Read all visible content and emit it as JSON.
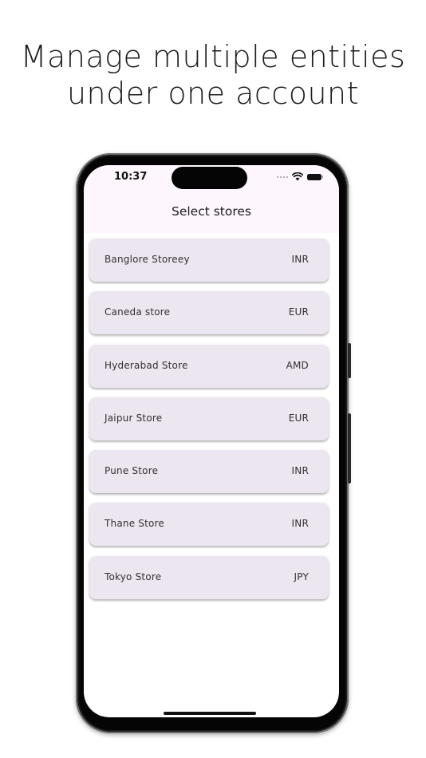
{
  "headline": {
    "line1": "Manage multiple entities",
    "line2": "under one account"
  },
  "status_bar": {
    "time": "10:37",
    "icons": [
      "signal-dots-icon",
      "wifi-icon",
      "battery-icon"
    ]
  },
  "app_bar": {
    "title": "Select stores"
  },
  "stores": [
    {
      "name": "Banglore Storeey",
      "currency": "INR"
    },
    {
      "name": "Caneda store",
      "currency": "EUR"
    },
    {
      "name": "Hyderabad Store",
      "currency": "AMD"
    },
    {
      "name": "Jaipur Store",
      "currency": "EUR"
    },
    {
      "name": "Pune Store",
      "currency": "INR"
    },
    {
      "name": "Thane Store",
      "currency": "INR"
    },
    {
      "name": "Tokyo Store",
      "currency": "JPY"
    }
  ],
  "colors": {
    "card_background": "#ece6f0",
    "app_bar_background": "#fdf7fd",
    "text": "#333033"
  }
}
